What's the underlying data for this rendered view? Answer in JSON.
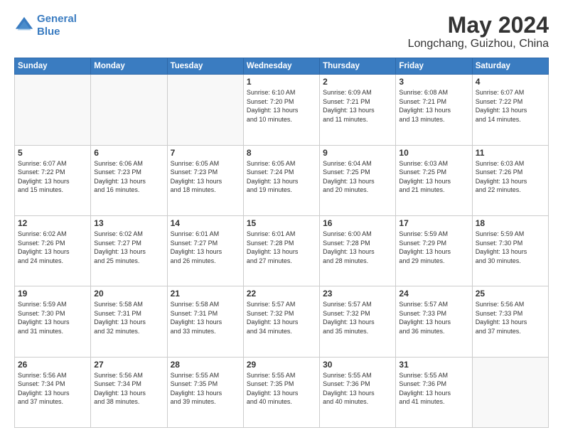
{
  "header": {
    "logo_line1": "General",
    "logo_line2": "Blue",
    "main_title": "May 2024",
    "sub_title": "Longchang, Guizhou, China"
  },
  "weekdays": [
    "Sunday",
    "Monday",
    "Tuesday",
    "Wednesday",
    "Thursday",
    "Friday",
    "Saturday"
  ],
  "weeks": [
    [
      {
        "day": "",
        "info": ""
      },
      {
        "day": "",
        "info": ""
      },
      {
        "day": "",
        "info": ""
      },
      {
        "day": "1",
        "info": "Sunrise: 6:10 AM\nSunset: 7:20 PM\nDaylight: 13 hours\nand 10 minutes."
      },
      {
        "day": "2",
        "info": "Sunrise: 6:09 AM\nSunset: 7:21 PM\nDaylight: 13 hours\nand 11 minutes."
      },
      {
        "day": "3",
        "info": "Sunrise: 6:08 AM\nSunset: 7:21 PM\nDaylight: 13 hours\nand 13 minutes."
      },
      {
        "day": "4",
        "info": "Sunrise: 6:07 AM\nSunset: 7:22 PM\nDaylight: 13 hours\nand 14 minutes."
      }
    ],
    [
      {
        "day": "5",
        "info": "Sunrise: 6:07 AM\nSunset: 7:22 PM\nDaylight: 13 hours\nand 15 minutes."
      },
      {
        "day": "6",
        "info": "Sunrise: 6:06 AM\nSunset: 7:23 PM\nDaylight: 13 hours\nand 16 minutes."
      },
      {
        "day": "7",
        "info": "Sunrise: 6:05 AM\nSunset: 7:23 PM\nDaylight: 13 hours\nand 18 minutes."
      },
      {
        "day": "8",
        "info": "Sunrise: 6:05 AM\nSunset: 7:24 PM\nDaylight: 13 hours\nand 19 minutes."
      },
      {
        "day": "9",
        "info": "Sunrise: 6:04 AM\nSunset: 7:25 PM\nDaylight: 13 hours\nand 20 minutes."
      },
      {
        "day": "10",
        "info": "Sunrise: 6:03 AM\nSunset: 7:25 PM\nDaylight: 13 hours\nand 21 minutes."
      },
      {
        "day": "11",
        "info": "Sunrise: 6:03 AM\nSunset: 7:26 PM\nDaylight: 13 hours\nand 22 minutes."
      }
    ],
    [
      {
        "day": "12",
        "info": "Sunrise: 6:02 AM\nSunset: 7:26 PM\nDaylight: 13 hours\nand 24 minutes."
      },
      {
        "day": "13",
        "info": "Sunrise: 6:02 AM\nSunset: 7:27 PM\nDaylight: 13 hours\nand 25 minutes."
      },
      {
        "day": "14",
        "info": "Sunrise: 6:01 AM\nSunset: 7:27 PM\nDaylight: 13 hours\nand 26 minutes."
      },
      {
        "day": "15",
        "info": "Sunrise: 6:01 AM\nSunset: 7:28 PM\nDaylight: 13 hours\nand 27 minutes."
      },
      {
        "day": "16",
        "info": "Sunrise: 6:00 AM\nSunset: 7:28 PM\nDaylight: 13 hours\nand 28 minutes."
      },
      {
        "day": "17",
        "info": "Sunrise: 5:59 AM\nSunset: 7:29 PM\nDaylight: 13 hours\nand 29 minutes."
      },
      {
        "day": "18",
        "info": "Sunrise: 5:59 AM\nSunset: 7:30 PM\nDaylight: 13 hours\nand 30 minutes."
      }
    ],
    [
      {
        "day": "19",
        "info": "Sunrise: 5:59 AM\nSunset: 7:30 PM\nDaylight: 13 hours\nand 31 minutes."
      },
      {
        "day": "20",
        "info": "Sunrise: 5:58 AM\nSunset: 7:31 PM\nDaylight: 13 hours\nand 32 minutes."
      },
      {
        "day": "21",
        "info": "Sunrise: 5:58 AM\nSunset: 7:31 PM\nDaylight: 13 hours\nand 33 minutes."
      },
      {
        "day": "22",
        "info": "Sunrise: 5:57 AM\nSunset: 7:32 PM\nDaylight: 13 hours\nand 34 minutes."
      },
      {
        "day": "23",
        "info": "Sunrise: 5:57 AM\nSunset: 7:32 PM\nDaylight: 13 hours\nand 35 minutes."
      },
      {
        "day": "24",
        "info": "Sunrise: 5:57 AM\nSunset: 7:33 PM\nDaylight: 13 hours\nand 36 minutes."
      },
      {
        "day": "25",
        "info": "Sunrise: 5:56 AM\nSunset: 7:33 PM\nDaylight: 13 hours\nand 37 minutes."
      }
    ],
    [
      {
        "day": "26",
        "info": "Sunrise: 5:56 AM\nSunset: 7:34 PM\nDaylight: 13 hours\nand 37 minutes."
      },
      {
        "day": "27",
        "info": "Sunrise: 5:56 AM\nSunset: 7:34 PM\nDaylight: 13 hours\nand 38 minutes."
      },
      {
        "day": "28",
        "info": "Sunrise: 5:55 AM\nSunset: 7:35 PM\nDaylight: 13 hours\nand 39 minutes."
      },
      {
        "day": "29",
        "info": "Sunrise: 5:55 AM\nSunset: 7:35 PM\nDaylight: 13 hours\nand 40 minutes."
      },
      {
        "day": "30",
        "info": "Sunrise: 5:55 AM\nSunset: 7:36 PM\nDaylight: 13 hours\nand 40 minutes."
      },
      {
        "day": "31",
        "info": "Sunrise: 5:55 AM\nSunset: 7:36 PM\nDaylight: 13 hours\nand 41 minutes."
      },
      {
        "day": "",
        "info": ""
      }
    ]
  ]
}
